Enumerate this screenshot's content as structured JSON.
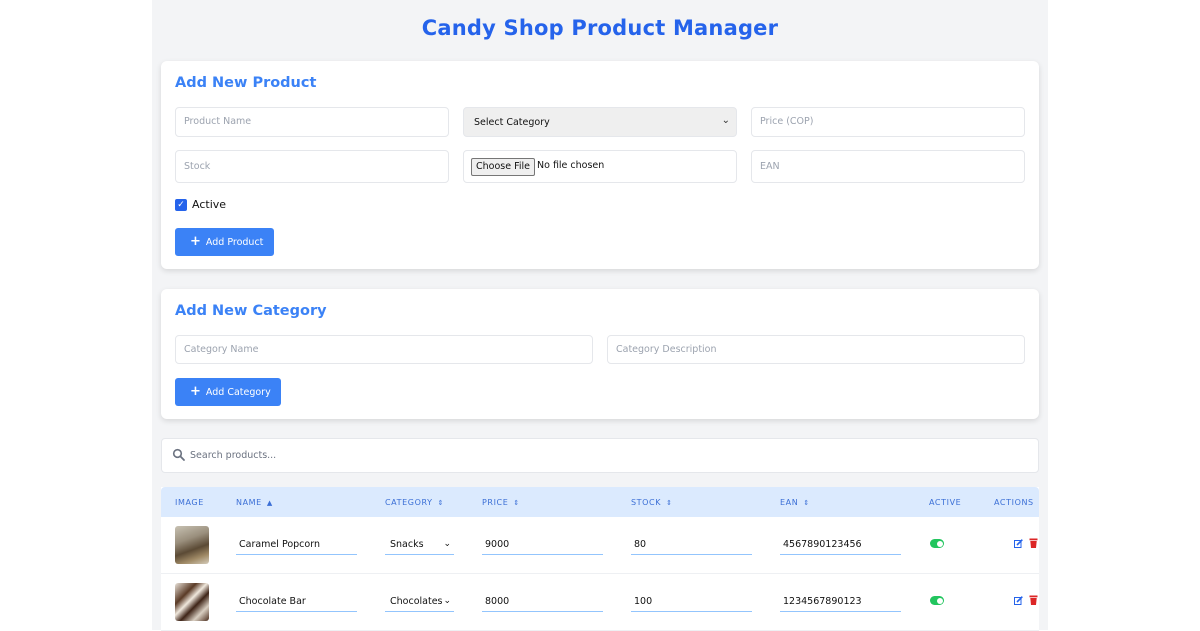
{
  "page": {
    "title": "Candy Shop Product Manager"
  },
  "product_form": {
    "title": "Add New Product",
    "name_placeholder": "Product Name",
    "category_selected": "Select Category",
    "price_placeholder": "Price (COP)",
    "stock_placeholder": "Stock",
    "file_button": "Choose File",
    "file_status": "No file chosen",
    "ean_placeholder": "EAN",
    "active_label": "Active",
    "active_checked": true,
    "submit_label": "Add Product"
  },
  "category_form": {
    "title": "Add New Category",
    "name_placeholder": "Category Name",
    "description_placeholder": "Category Description",
    "submit_label": "Add Category"
  },
  "search": {
    "placeholder": "Search products..."
  },
  "table": {
    "headers": {
      "image": "IMAGE",
      "name": "NAME",
      "category": "CATEGORY",
      "price": "PRICE",
      "stock": "STOCK",
      "ean": "EAN",
      "active": "ACTIVE",
      "actions": "ACTIONS"
    },
    "rows": [
      {
        "name": "Caramel Popcorn",
        "category": "Snacks",
        "price": "9000",
        "stock": "80",
        "ean": "4567890123456",
        "active": true,
        "image": "popcorn-photo"
      },
      {
        "name": "Chocolate Bar",
        "category": "Chocolates",
        "price": "8000",
        "stock": "100",
        "ean": "1234567890123",
        "active": true,
        "image": "chocolate-photo"
      }
    ]
  },
  "colors": {
    "accent": "#3b82f6",
    "title": "#2563eb",
    "header_bg": "#dbeafe",
    "toggle_on": "#22c55e",
    "delete": "#dc2626"
  },
  "icons": {
    "search": "search-icon",
    "add": "plus-icon",
    "edit": "edit-icon",
    "delete": "trash-icon",
    "sort": "sort-icon"
  }
}
